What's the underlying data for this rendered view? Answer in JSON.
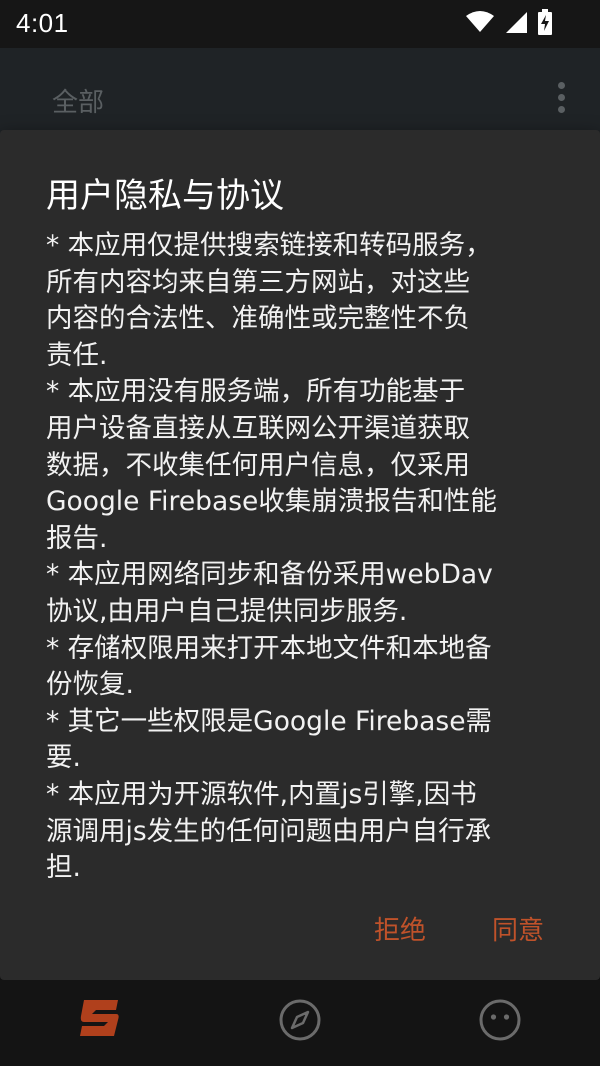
{
  "status_bar": {
    "time": "4:01",
    "icons": [
      "wifi-icon",
      "cellular-signal-icon",
      "battery-charging-icon"
    ]
  },
  "app_bar": {
    "title": "全部",
    "more_icon": "more-vert-icon"
  },
  "dialog": {
    "title": "用户隐私与协议",
    "content": "* 本应用仅提供搜索链接和转码服务，\n所有内容均来自第三方网站，对这些\n内容的合法性、准确性或完整性不负\n责任.\n* 本应用没有服务端，所有功能基于\n用户设备直接从互联网公开渠道获取\n数据，不收集任何用户信息，仅采用\nGoogle Firebase收集崩溃报告和性能\n报告.\n* 本应用网络同步和备份采用webDav\n协议,由用户自己提供同步服务.\n* 存储权限用来打开本地文件和本地备\n份恢复.\n* 其它一些权限是Google Firebase需\n要.\n* 本应用为开源软件,内置js引擎,因书\n源调用js发生的任何问题由用户自行承\n担.",
    "reject_label": "拒绝",
    "agree_label": "同意",
    "accent_color": "#c0522a"
  },
  "bottom_nav": {
    "items": [
      {
        "icon": "bookshelf-icon",
        "active": true
      },
      {
        "icon": "compass-icon",
        "active": false
      },
      {
        "icon": "face-icon",
        "active": false
      }
    ]
  }
}
